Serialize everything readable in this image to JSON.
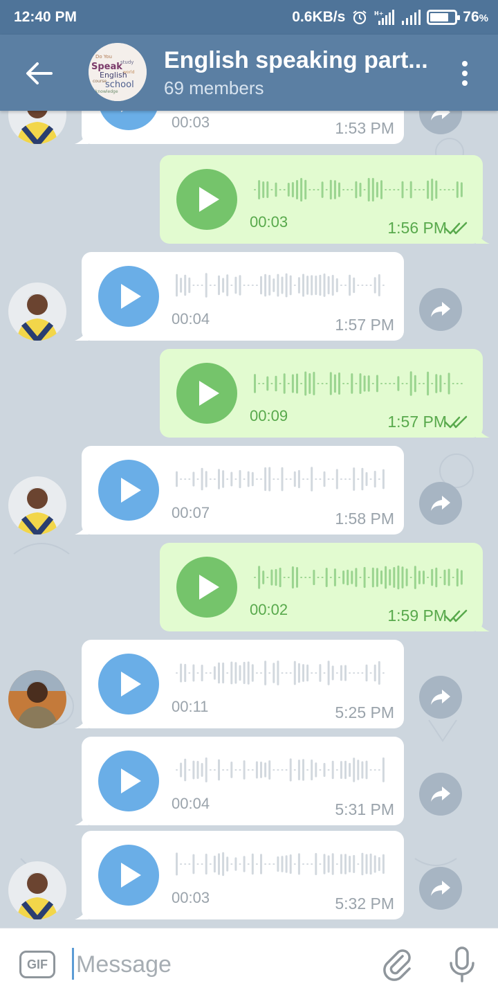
{
  "status_bar": {
    "time": "12:40 PM",
    "network_speed": "0.6KB/s",
    "battery": "76",
    "battery_suffix": "%",
    "battery_level": 0.76,
    "icons": [
      "alarm-icon",
      "hplus-signal-icon",
      "signal-icon",
      "battery-icon"
    ]
  },
  "header": {
    "title": "English speaking part...",
    "subtitle": "69 members",
    "avatar_words": [
      "Do You",
      "Speak",
      "English",
      "school",
      "course",
      "world",
      "study",
      "knowledge"
    ],
    "icons": [
      "back-arrow-icon",
      "more-vert-icon"
    ]
  },
  "messages": [
    {
      "dir": "in",
      "duration": "00:03",
      "time": "1:53 PM",
      "avatar": "person-a"
    },
    {
      "dir": "out",
      "duration": "00:03",
      "time": "1:56 PM"
    },
    {
      "dir": "in",
      "duration": "00:04",
      "time": "1:57 PM",
      "avatar": "person-a"
    },
    {
      "dir": "out",
      "duration": "00:09",
      "time": "1:57 PM"
    },
    {
      "dir": "in",
      "duration": "00:07",
      "time": "1:58 PM",
      "avatar": "person-a"
    },
    {
      "dir": "out",
      "duration": "00:02",
      "time": "1:59 PM"
    },
    {
      "dir": "in",
      "duration": "00:11",
      "time": "5:25 PM",
      "avatar": "person-b"
    },
    {
      "dir": "in",
      "duration": "00:04",
      "time": "5:31 PM"
    },
    {
      "dir": "in",
      "duration": "00:03",
      "time": "5:32 PM",
      "avatar": "person-a"
    }
  ],
  "input": {
    "placeholder": "Message",
    "gif_label": "GIF",
    "icons": [
      "paperclip-icon",
      "microphone-icon"
    ]
  },
  "colors": {
    "header": "#5b7fa3",
    "status_bar": "#4f7499",
    "incoming_bubble": "#ffffff",
    "outgoing_bubble": "#e2fbd0",
    "incoming_play": "#6aaee7",
    "outgoing_play": "#75c46b"
  }
}
